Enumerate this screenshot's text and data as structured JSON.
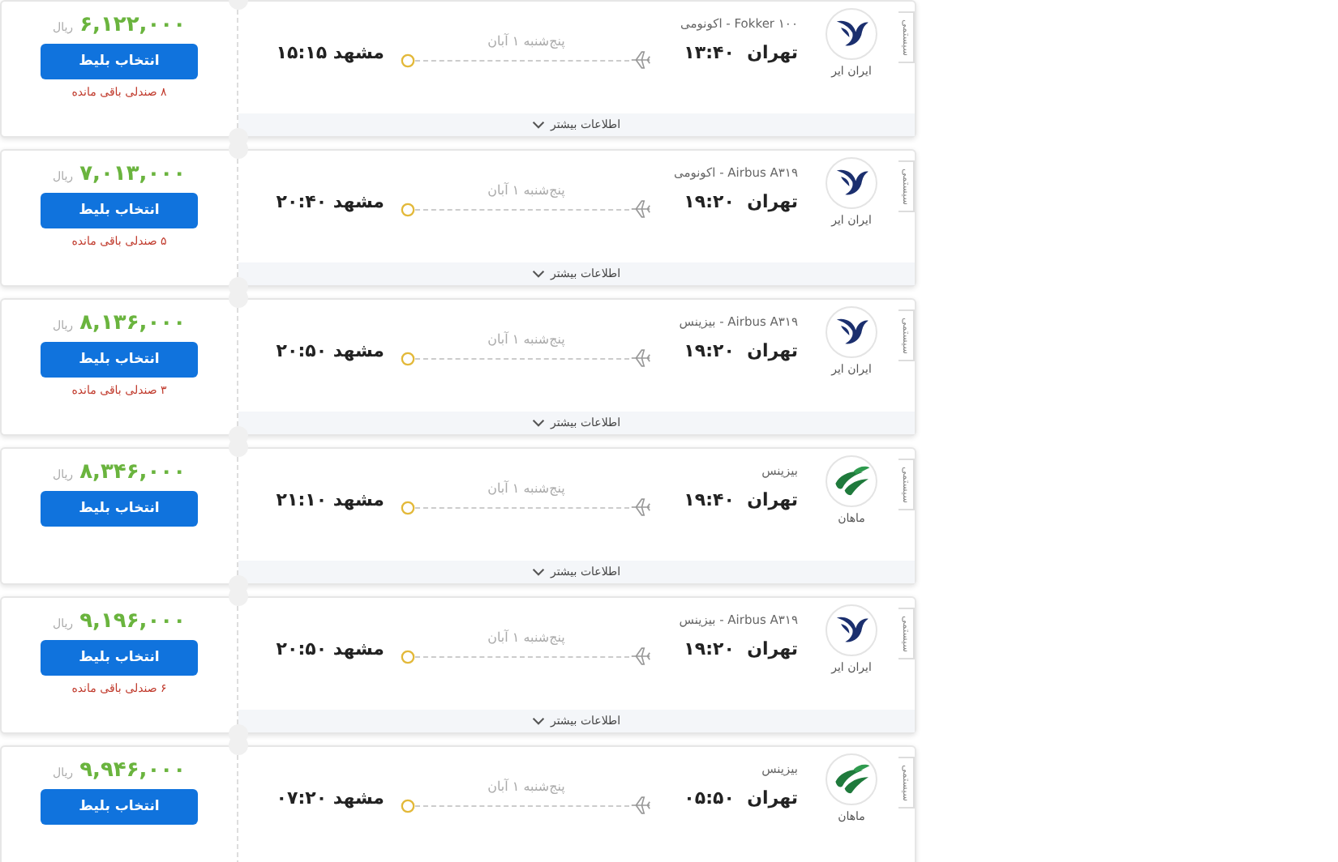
{
  "flights": [
    {
      "tag": "سیستمی",
      "airline": {
        "name": "ایران ایر",
        "kind": "iranair"
      },
      "cabin": "Fokker ۱۰۰ - اکونومی",
      "origin": "تهران",
      "departure": "۱۳:۴۰",
      "date": "پنج‌شنبه ۱ آبان",
      "destination": "مشهد",
      "arrival": "۱۵:۱۵",
      "price": "۶,۱۲۲,۰۰۰",
      "currency": "ریال",
      "button": "انتخاب بلیط",
      "seats": "۸ صندلی باقی مانده",
      "more": "اطلاعات بیشتر"
    },
    {
      "tag": "سیستمی",
      "airline": {
        "name": "ایران ایر",
        "kind": "iranair"
      },
      "cabin": "Airbus A۳۱۹ - اکونومی",
      "origin": "تهران",
      "departure": "۱۹:۲۰",
      "date": "پنج‌شنبه ۱ آبان",
      "destination": "مشهد",
      "arrival": "۲۰:۴۰",
      "price": "۷,۰۱۳,۰۰۰",
      "currency": "ریال",
      "button": "انتخاب بلیط",
      "seats": "۵ صندلی باقی مانده",
      "more": "اطلاعات بیشتر"
    },
    {
      "tag": "سیستمی",
      "airline": {
        "name": "ایران ایر",
        "kind": "iranair"
      },
      "cabin": "Airbus A۳۱۹ - بیزینس",
      "origin": "تهران",
      "departure": "۱۹:۲۰",
      "date": "پنج‌شنبه ۱ آبان",
      "destination": "مشهد",
      "arrival": "۲۰:۵۰",
      "price": "۸,۱۳۶,۰۰۰",
      "currency": "ریال",
      "button": "انتخاب بلیط",
      "seats": "۳ صندلی باقی مانده",
      "more": "اطلاعات بیشتر"
    },
    {
      "tag": "سیستمی",
      "airline": {
        "name": "ماهان",
        "kind": "mahan"
      },
      "cabin": "بیزینس",
      "origin": "تهران",
      "departure": "۱۹:۴۰",
      "date": "پنج‌شنبه ۱ آبان",
      "destination": "مشهد",
      "arrival": "۲۱:۱۰",
      "price": "۸,۳۴۶,۰۰۰",
      "currency": "ریال",
      "button": "انتخاب بلیط",
      "more": "اطلاعات بیشتر"
    },
    {
      "tag": "سیستمی",
      "airline": {
        "name": "ایران ایر",
        "kind": "iranair"
      },
      "cabin": "Airbus A۳۱۹ - بیزینس",
      "origin": "تهران",
      "departure": "۱۹:۲۰",
      "date": "پنج‌شنبه ۱ آبان",
      "destination": "مشهد",
      "arrival": "۲۰:۵۰",
      "price": "۹,۱۹۶,۰۰۰",
      "currency": "ریال",
      "button": "انتخاب بلیط",
      "seats": "۶ صندلی باقی مانده",
      "more": "اطلاعات بیشتر"
    },
    {
      "tag": "سیستمی",
      "airline": {
        "name": "ماهان",
        "kind": "mahan"
      },
      "cabin": "بیزینس",
      "origin": "تهران",
      "departure": "۰۵:۵۰",
      "date": "پنج‌شنبه ۱ آبان",
      "destination": "مشهد",
      "arrival": "۰۷:۲۰",
      "price": "۹,۹۴۶,۰۰۰",
      "currency": "ریال",
      "button": "انتخاب بلیط"
    }
  ]
}
